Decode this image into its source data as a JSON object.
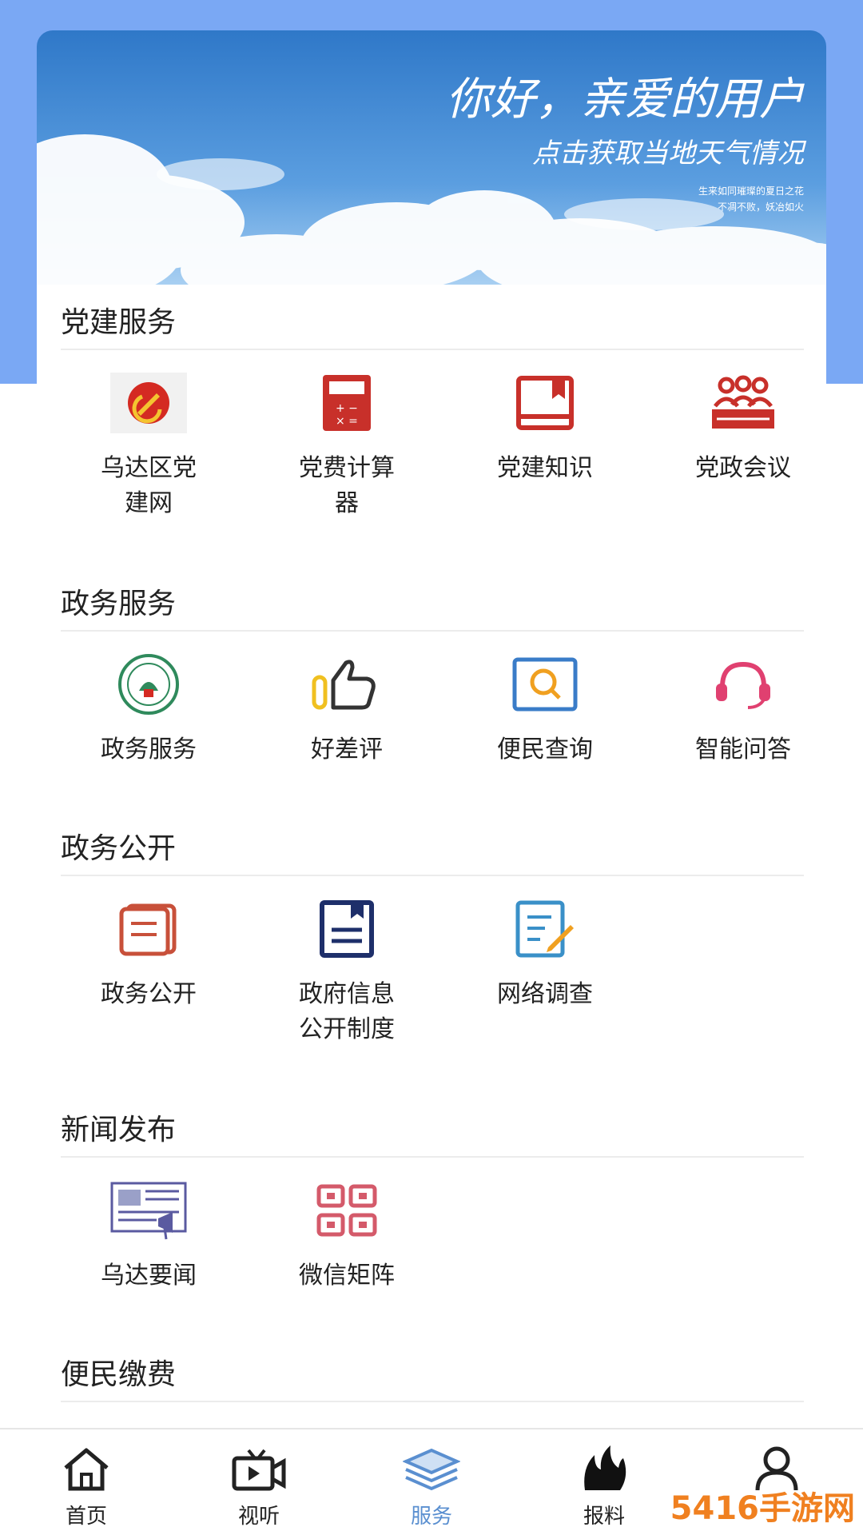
{
  "banner": {
    "headline": "你好，亲爱的用户",
    "subline": "点击获取当地天气情况",
    "small_line1": "生来如同璀璨的夏日之花",
    "small_line2": "不凋不败，妖冶如火"
  },
  "sections": [
    {
      "title": "党建服务",
      "items": [
        {
          "label": "乌达区党建网",
          "icon": "party-emblem-icon"
        },
        {
          "label": "党费计算器",
          "icon": "calculator-icon"
        },
        {
          "label": "党建知识",
          "icon": "book-icon"
        },
        {
          "label": "党政会议",
          "icon": "meeting-icon"
        }
      ]
    },
    {
      "title": "政务服务",
      "items": [
        {
          "label": "政务服务",
          "icon": "gov-seal-icon"
        },
        {
          "label": "好差评",
          "icon": "thumbs-up-icon"
        },
        {
          "label": "便民查询",
          "icon": "search-icon"
        },
        {
          "label": "智能问答",
          "icon": "headset-icon"
        }
      ]
    },
    {
      "title": "政务公开",
      "items": [
        {
          "label": "政务公开",
          "icon": "document-stack-icon"
        },
        {
          "label": "政府信息公开制度",
          "icon": "document-icon"
        },
        {
          "label": "网络调查",
          "icon": "survey-edit-icon"
        }
      ]
    },
    {
      "title": "新闻发布",
      "items": [
        {
          "label": "乌达要闻",
          "icon": "newspaper-icon"
        },
        {
          "label": "微信矩阵",
          "icon": "grid-icon"
        }
      ]
    },
    {
      "title": "便民缴费",
      "items": []
    }
  ],
  "tabbar": [
    {
      "label": "首页",
      "icon": "home-icon"
    },
    {
      "label": "视听",
      "icon": "video-icon"
    },
    {
      "label": "服务",
      "icon": "layers-icon",
      "active": true
    },
    {
      "label": "报料",
      "icon": "fire-icon"
    },
    {
      "label": "",
      "icon": "user-icon"
    }
  ],
  "watermark": "5416手游网",
  "colors": {
    "accent": "#5a8fd0",
    "party_red": "#c8302a",
    "top_bg": "#7aa8f4"
  }
}
